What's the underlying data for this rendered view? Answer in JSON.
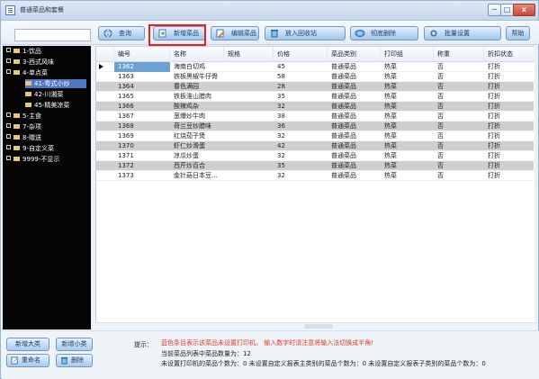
{
  "window": {
    "title": "普通菜品和套餐",
    "controls": {
      "minimize": "─",
      "maximize": "□",
      "close": "x"
    }
  },
  "toolbar": {
    "search_value": "",
    "search_label": "查询",
    "new_label": "新增菜品",
    "edit_label": "编辑菜品",
    "recycle_label": "放入回收站",
    "delete_label": "彻底删除",
    "batch_label": "批量设置",
    "help_label": "帮助"
  },
  "tree": {
    "items": [
      {
        "label": "1-饮品",
        "level": 0,
        "selected": false,
        "icon": "folder-icon"
      },
      {
        "label": "3-西式风味",
        "level": 0,
        "selected": false,
        "icon": "folder-icon"
      },
      {
        "label": "4-单点菜",
        "level": 0,
        "selected": false,
        "icon": "folder-icon"
      },
      {
        "label": "41-粤式小炒",
        "level": 1,
        "selected": true,
        "icon": "folder-icon"
      },
      {
        "label": "42-川湘菜",
        "level": 1,
        "selected": false,
        "icon": "folder-icon"
      },
      {
        "label": "45-精美凉菜",
        "level": 1,
        "selected": false,
        "icon": "folder-icon"
      },
      {
        "label": "5-主食",
        "level": 0,
        "selected": false,
        "icon": "folder-icon"
      },
      {
        "label": "7-杂项",
        "level": 0,
        "selected": false,
        "icon": "folder-icon"
      },
      {
        "label": "8-赠送",
        "level": 0,
        "selected": false,
        "icon": "folder-icon"
      },
      {
        "label": "9-自定义菜",
        "level": 0,
        "selected": false,
        "icon": "folder-icon"
      },
      {
        "label": "9999-不显示",
        "level": 0,
        "selected": false,
        "icon": "folder-icon"
      }
    ]
  },
  "grid": {
    "columns": [
      "编号",
      "名称",
      "规格",
      "价格",
      "菜品类别",
      "打印组",
      "称重",
      "折扣状态"
    ],
    "rows": [
      [
        "1362",
        "海南白切鸡",
        "",
        "45",
        "普通菜品",
        "热菜",
        "否",
        "打折"
      ],
      [
        "1363",
        "铁板黑椒牛仔骨",
        "",
        "58",
        "普通菜品",
        "热菜",
        "否",
        "打折"
      ],
      [
        "1364",
        "春色满园",
        "",
        "28",
        "普通菜品",
        "热菜",
        "否",
        "打折"
      ],
      [
        "1365",
        "铁板淮山腊肉",
        "",
        "35",
        "普通菜品",
        "热菜",
        "否",
        "打折"
      ],
      [
        "1366",
        "酸辣鸡杂",
        "",
        "32",
        "普通菜品",
        "热菜",
        "否",
        "打折"
      ],
      [
        "1367",
        "葱爆炒牛肉",
        "",
        "38",
        "普通菜品",
        "热菜",
        "否",
        "打折"
      ],
      [
        "1368",
        "荷兰豆炒腊味",
        "",
        "36",
        "普通菜品",
        "热菜",
        "否",
        "打折"
      ],
      [
        "1369",
        "红烧茄子煲",
        "",
        "32",
        "普通菜品",
        "热菜",
        "否",
        "打折"
      ],
      [
        "1370",
        "虾仁炒滑蛋",
        "",
        "42",
        "普通菜品",
        "热菜",
        "否",
        "打折"
      ],
      [
        "1371",
        "凉瓜炒蛋",
        "",
        "32",
        "普通菜品",
        "热菜",
        "否",
        "打折"
      ],
      [
        "1372",
        "西芹炒百合",
        "",
        "35",
        "普通菜品",
        "热菜",
        "否",
        "打折"
      ],
      [
        "1373",
        "金针菇日本豆...",
        "",
        "32",
        "普通菜品",
        "热菜",
        "否",
        "打折"
      ]
    ]
  },
  "bottom": {
    "new_major_label": "新增大类",
    "new_minor_label": "新增小类",
    "rename_label": "重命名",
    "delete_label": "删除",
    "tip_label": "提示：",
    "tip_warning": "蓝色条目表示该菜品未设置打印机。  输入数字时请注意将输入法切换成半角!",
    "stat_dish_count": "当前菜品列表中菜品数量为：12",
    "stat_unset_printer": "未设置打印机的菜品个数为：0    未设置自定义报表主类别的菜品个数为：0    未设置自定义报表子类别的菜品个数为：0"
  }
}
